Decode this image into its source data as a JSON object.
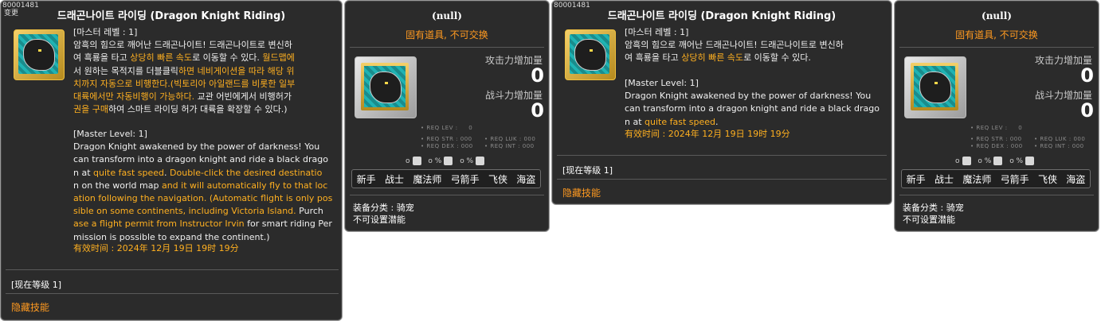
{
  "panel1": {
    "id": "80001481",
    "tag": "变更",
    "title": "드래곤나이트 라이딩 (Dragon Knight Riding)",
    "kr_lines": [
      "[마스터 레벨 : 1]",
      "암흑의 힘으로 깨어난 드래곤나이트! 드래곤나이트로 변신하",
      "여 흑룡을 타고 |상당히 빠른 속도|로 이동할 수 있다. |월드맵에",
      "|서 원하는 목적지를 더블클릭|하면 네비게이션을 따라 해당 위",
      "치까지 자동으로 비행한다.(빅토리아 아일랜드를 비롯한 일부",
      "대륙에서만 자동비행이 가능하다. |교관 어빈에게서 비행허가",
      "|권을 구매|하여 스마트 라이딩 허가 대륙을 확장할 수 있다.)"
    ],
    "en_lines": [
      "[Master Level: 1]",
      "Dragon Knight awakened by the power of darkness! You",
      "can transform into a dragon knight and ride a black drago",
      "n at |quite fast speed|. |Double-click the desired destinatio",
      "|n on the world map| and it will automatically fly to that loc",
      "ation following the navigation. (Automatic flight is only pos",
      "sible on some continents, including Victoria Island. |Purch",
      "|ase a flight permit from Instructor Irvin| for smart riding Per",
      "mission is possible to expand the continent.)"
    ],
    "expiry": "有效时间 : 2024年 12月 19日 19时 19分",
    "current_level": "[现在等级 1]",
    "hidden_skill": "隐藏技能"
  },
  "panel2": {
    "title": "(null)",
    "subtitle": "固有道具, 不可交换",
    "attack_label": "攻击力增加量",
    "attack_value": "0",
    "combat_label": "战斗力增加量",
    "combat_value": "0",
    "req_lev": "• REQ LEV :",
    "req_lev_val": "0",
    "req_str": "• REQ STR : 000",
    "req_luk": "• REQ LUK : 000",
    "req_dex": "• REQ DEX : 000",
    "req_int": "• REQ INT : 000",
    "misc": [
      "o",
      "o %",
      "o %"
    ],
    "jobs": [
      "新手",
      "战士",
      "魔法师",
      "弓箭手",
      "飞侠",
      "海盗"
    ],
    "category": "装备分类 : 骑宠",
    "potential": "不可设置潜能"
  },
  "panel3": {
    "id": "80001481",
    "title": "드래곤나이트 라이딩 (Dragon Knight Riding)",
    "kr_lines": [
      "[마스터 레벨 : 1]",
      "암흑의 힘으로 깨어난 드래곤나이트! 드래곤나이트로 변신하",
      "여 흑룡을 타고 |상당히 빠른 속도|로 이동할 수 있다."
    ],
    "en_lines": [
      "[Master Level: 1]",
      "Dragon Knight awakened by the power of darkness! You",
      "can transform into a dragon knight and ride a black drago",
      "n at |quite fast speed|."
    ],
    "expiry": "有效时间 : 2024年 12月 19日 19时 19分",
    "current_level": "[现在等级 1]",
    "hidden_skill": "隐藏技能"
  },
  "panel4": {
    "title": "(null)",
    "subtitle": "固有道具, 不可交换",
    "attack_label": "攻击力增加量",
    "attack_value": "0",
    "combat_label": "战斗力增加量",
    "combat_value": "0",
    "req_lev": "• REQ LEV :",
    "req_lev_val": "0",
    "req_str": "• REQ STR : 000",
    "req_luk": "• REQ LUK : 000",
    "req_dex": "• REQ DEX : 000",
    "req_int": "• REQ INT : 000",
    "misc": [
      "o",
      "o %",
      "o %"
    ],
    "jobs": [
      "新手",
      "战士",
      "魔法师",
      "弓箭手",
      "飞侠",
      "海盗"
    ],
    "category": "装备分类 : 骑宠",
    "potential": "不可设置潜能"
  }
}
